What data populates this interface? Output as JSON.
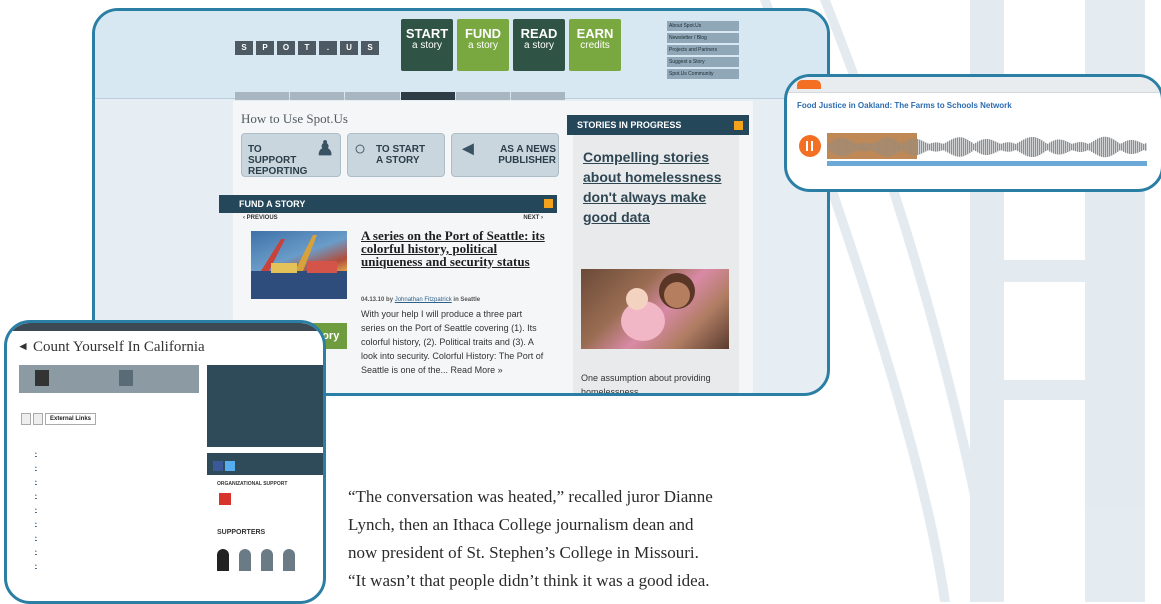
{
  "main": {
    "logo_letters": [
      "S",
      "P",
      "O",
      "T",
      ".",
      "U",
      "S"
    ],
    "nav": [
      {
        "line1": "START",
        "line2": "a story"
      },
      {
        "line1": "FUND",
        "line2": "a story"
      },
      {
        "line1": "READ",
        "line2": "a story"
      },
      {
        "line1": "EARN",
        "line2": "credits"
      }
    ],
    "top_links": [
      "About Spot.Us",
      "Newsletter / Blog",
      "Projects and Partners",
      "Suggest a Story",
      "Spot.Us Community"
    ],
    "how_to_title": "How to Use Spot.Us",
    "how_buttons": [
      "TO SUPPORT REPORTING",
      "TO START A STORY",
      "AS A NEWS PUBLISHER"
    ],
    "fund_header": "FUND A STORY",
    "prev_label": "‹ PREVIOUS",
    "next_label": "NEXT ›",
    "story": {
      "title": "A series on the Port of Seattle: its colorful history, political uniqueness and security status",
      "meta_date": "04.13.10 by",
      "meta_author": "Johnathan Fitzpatrick",
      "meta_place": "in Seattle",
      "text": "With your help I will produce a three part series on the Port of Seattle covering (1). Its colorful history, (2). Political traits and (3). A look into security.  Colorful History: The Port of Seattle is one of the... Read More »",
      "fund_button": "Fund this Story"
    },
    "stories_in_progress": {
      "header": "STORIES IN PROGRESS",
      "title": "Compelling stories about homelessness don't always make good data",
      "text": "One assumption about providing homelessness"
    }
  },
  "soundcloud": {
    "title": "Food Justice in Oakland: The Farms to Schools Network"
  },
  "california": {
    "title": "Count Yourself In California",
    "tab_active": "External Links",
    "org_support": "ORGANIZATIONAL SUPPORT",
    "supporters": "SUPPORTERS"
  },
  "quote": [
    "“The conversation was heated,” recalled juror Dianne",
    "Lynch, then an Ithaca College journalism dean and",
    "now president of St. Stephen’s College in Missouri.",
    "“It wasn’t that people didn’t think it was a good idea."
  ],
  "colors": {
    "panel_border": "#2b7fa4",
    "nav_dark": "#2f5345",
    "nav_green": "#78a83f",
    "header_bar": "#24475a",
    "rss": "#f2a31b",
    "soundcloud_orange": "#f26f23"
  }
}
